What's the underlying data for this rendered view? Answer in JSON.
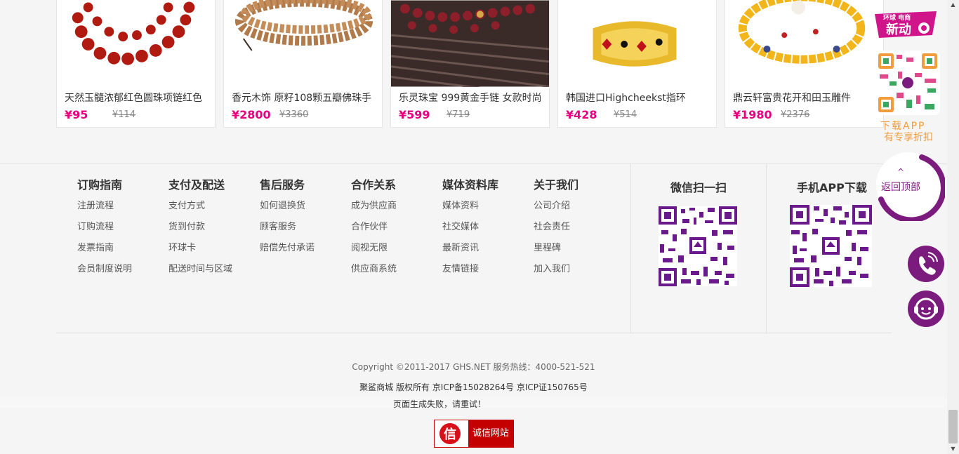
{
  "products": [
    {
      "name": "天然玉髓浓郁红色圆珠项链红色",
      "price": "¥95",
      "old_price": "¥114"
    },
    {
      "name": "香元木饰 原籽108颗五瓣佛珠手",
      "price": "¥2800",
      "old_price": "¥3360"
    },
    {
      "name": "乐灵珠宝 999黄金手链 女款时尚",
      "price": "¥599",
      "old_price": "¥719"
    },
    {
      "name": "韩国进口Highcheekst指环",
      "price": "¥428",
      "old_price": "¥514"
    },
    {
      "name": "鼎云轩富贵花开和田玉雕件",
      "price": "¥1980",
      "old_price": "¥2376"
    }
  ],
  "footer": {
    "columns": [
      {
        "title": "订购指南",
        "links": [
          "注册流程",
          "订购流程",
          "发票指南",
          "会员制度说明"
        ]
      },
      {
        "title": "支付及配送",
        "links": [
          "支付方式",
          "货到付款",
          "环球卡",
          "配送时间与区域"
        ]
      },
      {
        "title": "售后服务",
        "links": [
          "如何退换货",
          "顾客服务",
          "赔偿先付承诺"
        ]
      },
      {
        "title": "合作关系",
        "links": [
          "成为供应商",
          "合作伙伴",
          "阅视无限",
          "供应商系统"
        ]
      },
      {
        "title": "媒体资料库",
        "links": [
          "媒体资料",
          "社交媒体",
          "最新资讯",
          "友情链接"
        ]
      },
      {
        "title": "关于我们",
        "links": [
          "公司介绍",
          "社会责任",
          "里程碑",
          "加入我们"
        ]
      }
    ],
    "wechat_title": "微信扫一扫",
    "app_title": "手机APP下载",
    "copyright": "Copyright ©2011-2017 GHS.NET  服务热线：4000-521-521",
    "license": "聚鲨商城 版权所有 京ICP备15028264号 京ICP证150765号",
    "fail_message": "页面生成失败，请重试！",
    "trust_label": "诚信网站",
    "trust_logo_char": "信"
  },
  "side": {
    "promo_text": "新动",
    "promo_small": "环球 电商",
    "download_line1": "下载APP",
    "download_line2": "有专享折扣",
    "back_top_arrow": "^",
    "back_top": "返回顶部",
    "phone_icon": "phone-icon",
    "service_icon": "customer-service-icon"
  },
  "colors": {
    "accent": "#7b1b7e",
    "price": "#e4007f",
    "trust_red": "#c40000",
    "download_orange": "#f39c3c"
  }
}
